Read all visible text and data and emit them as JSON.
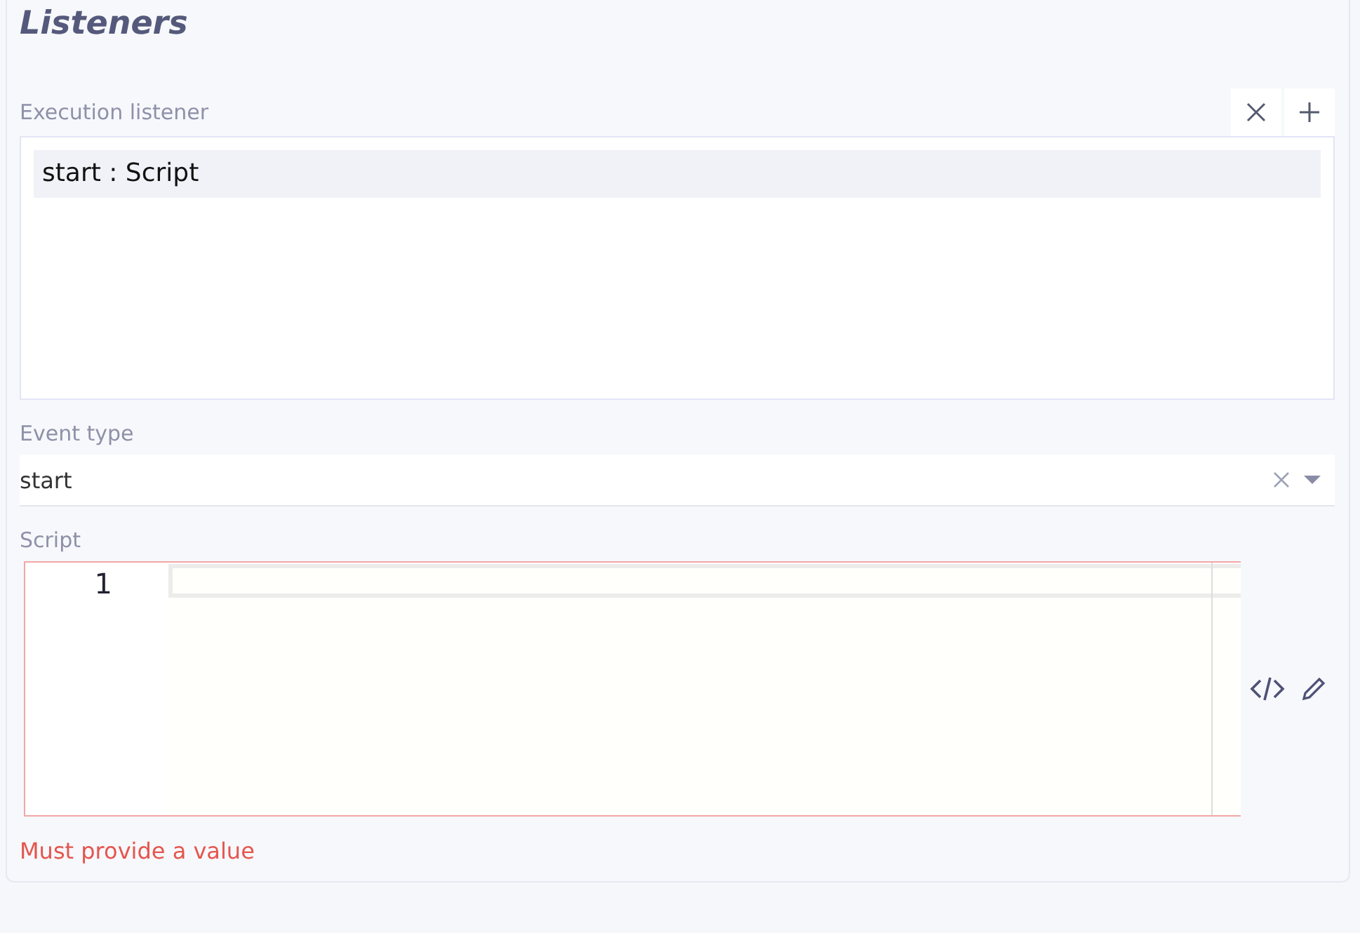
{
  "section": {
    "title": "Listeners"
  },
  "execution_listener": {
    "label": "Execution listener",
    "actions": [
      {
        "kind": "remove"
      },
      {
        "kind": "add"
      }
    ],
    "items": [
      {
        "label": "start : Script",
        "selected": true
      }
    ]
  },
  "event_type": {
    "label": "Event type",
    "value": "start"
  },
  "script": {
    "label": "Script",
    "line_numbers": [
      "1"
    ],
    "error": "Must provide a value"
  }
}
